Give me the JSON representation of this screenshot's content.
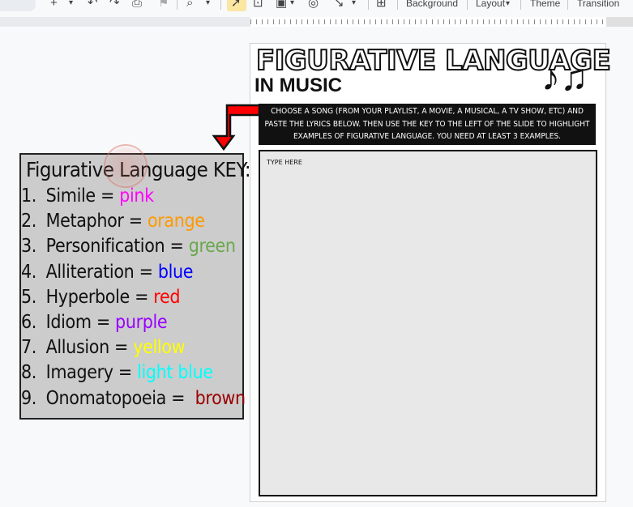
{
  "toolbar": {
    "background_label": "Background",
    "layout_label": "Layout",
    "theme_label": "Theme",
    "transition_label": "Transition"
  },
  "slide": {
    "title": "FIGURATIVE LANGUAGE",
    "subtitle": "IN MUSIC",
    "music_icon": "music-notes-icon",
    "instructions": "CHOOSE A SONG (FROM YOUR PLAYLIST, A MOVIE, A MUSICAL, A TV SHOW, ETC) AND PASTE THE LYRICS BELOW. THEN USE THE KEY TO THE LEFT OF THE SLIDE TO HIGHLIGHT EXAMPLES OF FIGURATIVE LANGUAGE. YOU NEED AT LEAST 3 EXAMPLES.",
    "type_here": "TYPE HERE"
  },
  "key": {
    "title": "Figurative Language KEY:",
    "items": [
      {
        "num": "1.",
        "term": "Simile = ",
        "color_word": "pink",
        "color": "#ff00ff"
      },
      {
        "num": "2.",
        "term": "Metaphor = ",
        "color_word": "orange",
        "color": "#ff9900"
      },
      {
        "num": "3.",
        "term": "Personification = ",
        "color_word": "green",
        "color": "#6aa84f"
      },
      {
        "num": "4.",
        "term": "Alliteration = ",
        "color_word": "blue",
        "color": "#0000ff"
      },
      {
        "num": "5.",
        "term": "Hyperbole = ",
        "color_word": "red",
        "color": "#ff0000"
      },
      {
        "num": "6.",
        "term": "Idiom = ",
        "color_word": "purple",
        "color": "#9900ff"
      },
      {
        "num": "7.",
        "term": "Allusion = ",
        "color_word": "yellow",
        "color": "#ffff00"
      },
      {
        "num": "8.",
        "term": "Imagery = ",
        "color_word": "light blue",
        "color": "#00ffff"
      },
      {
        "num": "9.",
        "term": "Onomatopoeia =  ",
        "color_word": "brown",
        "color": "#990000"
      }
    ]
  },
  "colors": {
    "arrow_fill": "#ff0000",
    "arrow_stroke": "#111111",
    "tool_selected": "#fbe6a2"
  }
}
